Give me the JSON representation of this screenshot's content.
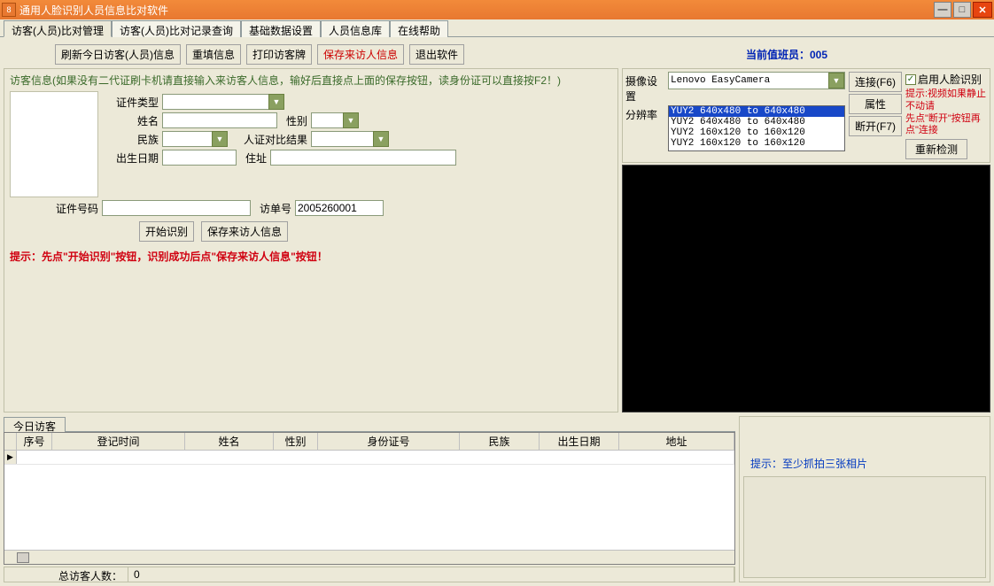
{
  "window": {
    "title": "通用人脸识别人员信息比对软件"
  },
  "tabs": [
    "访客(人员)比对管理",
    "访客(人员)比对记录查询",
    "基础数据设置",
    "人员信息库",
    "在线帮助"
  ],
  "toolbar": {
    "refresh": "刷新今日访客(人员)信息",
    "reset": "重填信息",
    "print": "打印访客牌",
    "save": "保存来访人信息",
    "exit": "退出软件",
    "staff_label": "当前值班员：",
    "staff_no": "005"
  },
  "visit": {
    "group_label": "访客信息(如果没有二代证刷卡机请直接输入来访客人信息，输好后直接点上面的保存按钮，读身份证可以直接按F2！)",
    "idtype_label": "证件类型",
    "idtype_value": "",
    "name_label": "姓名",
    "name_value": "",
    "gender_label": "性别",
    "gender_value": "",
    "nation_label": "民族",
    "nation_value": "",
    "compare_label": "人证对比结果",
    "compare_value": "",
    "birth_label": "出生日期",
    "birth_value": "",
    "addr_label": "住址",
    "addr_value": "",
    "idno_label": "证件号码",
    "idno_value": "",
    "visitno_label": "访单号",
    "visitno_value": "2005260001",
    "start_btn": "开始识别",
    "save_btn": "保存来访人信息",
    "hint": "提示：先点\"开始识别\"按钮，识别成功后点\"保存来访人信息\"按钮！"
  },
  "camera": {
    "device_label": "摄像设置",
    "device_value": "Lenovo EasyCamera",
    "res_label": "分辨率",
    "res_options": [
      "YUY2 640x480 to 640x480",
      "YUY2 640x480 to 640x480",
      "YUY2 160x120 to 160x120",
      "YUY2 160x120 to 160x120"
    ],
    "connect_btn": "连接(F6)",
    "prop_btn": "属性",
    "disconnect_btn": "断开(F7)",
    "enable_chk": "启用人脸识别",
    "hint1": "提示:视频如果静止不动请",
    "hint2": "先点\"断开\"按钮再点\"连接",
    "redetect_btn": "重新检测"
  },
  "grid": {
    "tab": "今日访客",
    "cols": [
      "序号",
      "登记时间",
      "姓名",
      "性别",
      "身份证号",
      "民族",
      "出生日期",
      "地址"
    ],
    "total_label": "总访客人数：",
    "total_value": "0"
  },
  "rightpanel": {
    "hint": "提示：至少抓拍三张相片"
  }
}
